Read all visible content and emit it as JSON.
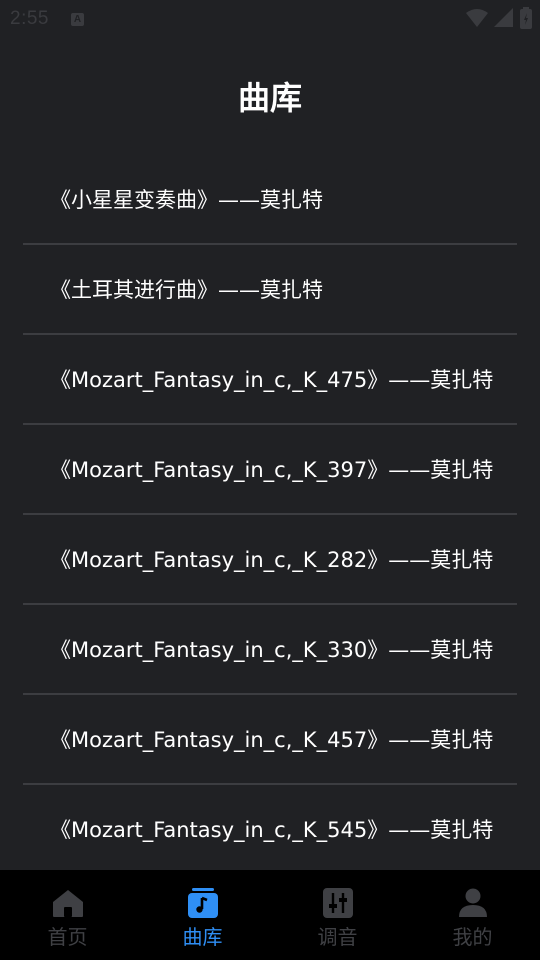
{
  "status_bar": {
    "time": "2:55",
    "notification_icon": "a-notification-icon"
  },
  "page": {
    "title": "曲库"
  },
  "songs": [
    {
      "label": "《小星星变奏曲》——莫扎特"
    },
    {
      "label": "《土耳其进行曲》——莫扎特"
    },
    {
      "label": "《Mozart_Fantasy_in_c,_K_475》——莫扎特"
    },
    {
      "label": "《Mozart_Fantasy_in_c,_K_397》——莫扎特"
    },
    {
      "label": "《Mozart_Fantasy_in_c,_K_282》——莫扎特"
    },
    {
      "label": "《Mozart_Fantasy_in_c,_K_330》——莫扎特"
    },
    {
      "label": "《Mozart_Fantasy_in_c,_K_457》——莫扎特"
    },
    {
      "label": "《Mozart_Fantasy_in_c,_K_545》——莫扎特"
    }
  ],
  "bottom_nav": {
    "items": [
      {
        "label": "首页",
        "icon": "home-icon",
        "active": false
      },
      {
        "label": "曲库",
        "icon": "music-library-icon",
        "active": true
      },
      {
        "label": "调音",
        "icon": "tuner-icon",
        "active": false
      },
      {
        "label": "我的",
        "icon": "profile-icon",
        "active": false
      }
    ]
  },
  "colors": {
    "background": "#202124",
    "nav_background": "#000000",
    "accent": "#2f8ff5",
    "inactive": "#3f4044",
    "divider": "#3c3d41"
  }
}
